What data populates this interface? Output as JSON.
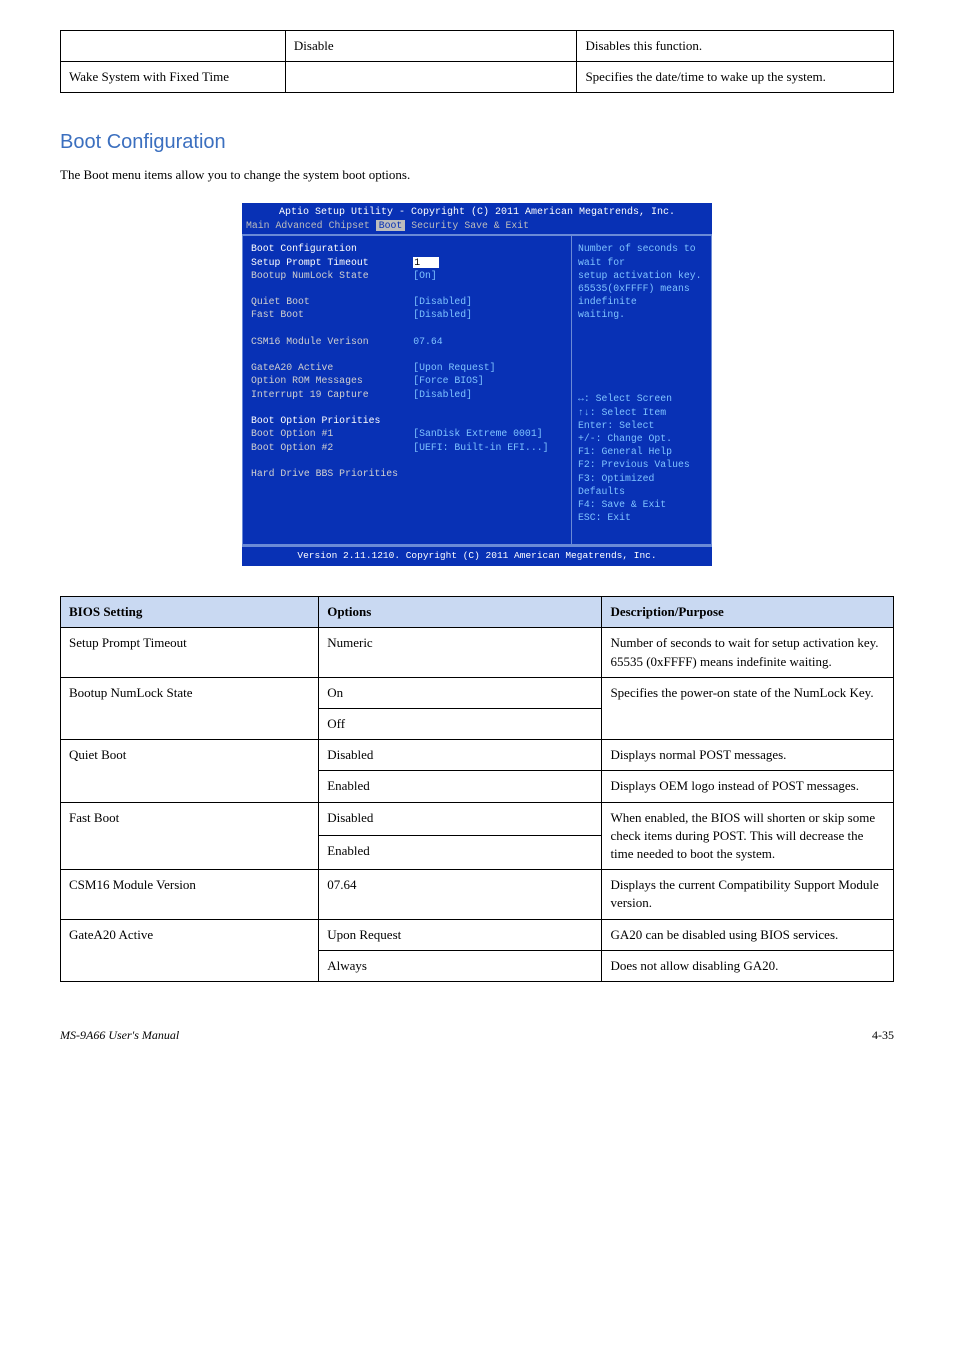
{
  "top_table": {
    "rows": [
      {
        "c1": "",
        "c2": "Disable",
        "c3": "Disables this function."
      },
      {
        "c1": "Wake System with Fixed Time",
        "c2": "",
        "c3": "Specifies the date/time to wake up the system."
      }
    ]
  },
  "section": {
    "heading": "Boot Configuration",
    "sub": "The Boot menu items allow you to change the system boot options."
  },
  "bios": {
    "header": "Aptio Setup Utility - Copyright (C) 2011 American Megatrends, Inc.",
    "tabs": [
      "Main",
      "Advanced",
      "Chipset",
      "Boot",
      "Security",
      "Save & Exit"
    ],
    "selected_tab": 3,
    "left_rows": [
      {
        "lbl": "Boot Configuration",
        "val": "",
        "white": true
      },
      {
        "lbl": "Setup Prompt Timeout",
        "val": "1",
        "white": true,
        "hival": true
      },
      {
        "lbl": "Bootup NumLock State",
        "val": "[On]"
      },
      {
        "lbl": "",
        "val": ""
      },
      {
        "lbl": "Quiet Boot",
        "val": "[Disabled]"
      },
      {
        "lbl": "Fast Boot",
        "val": "[Disabled]"
      },
      {
        "lbl": "",
        "val": ""
      },
      {
        "lbl": "CSM16 Module Verison",
        "val": "07.64"
      },
      {
        "lbl": "",
        "val": ""
      },
      {
        "lbl": "GateA20 Active",
        "val": "[Upon Request]"
      },
      {
        "lbl": "Option ROM Messages",
        "val": "[Force BIOS]"
      },
      {
        "lbl": "Interrupt 19 Capture",
        "val": "[Disabled]"
      },
      {
        "lbl": "",
        "val": ""
      },
      {
        "lbl": "Boot Option Priorities",
        "val": "",
        "white": true
      },
      {
        "lbl": "Boot Option #1",
        "val": "[SanDisk Extreme 0001]"
      },
      {
        "lbl": "Boot Option #2",
        "val": "[UEFI: Built-in EFI...]"
      },
      {
        "lbl": "",
        "val": ""
      },
      {
        "lbl": "Hard Drive BBS Priorities",
        "val": ""
      }
    ],
    "help": [
      "Number of seconds to wait for",
      "setup activation key.",
      "65535(0xFFFF) means indefinite",
      "waiting."
    ],
    "keys": [
      "↔: Select Screen",
      "↑↓: Select Item",
      "Enter: Select",
      "+/-: Change Opt.",
      "F1: General Help",
      "F2: Previous Values",
      "F3: Optimized Defaults",
      "F4: Save & Exit",
      "ESC: Exit"
    ],
    "footer": "Version 2.11.1210. Copyright (C) 2011 American Megatrends, Inc."
  },
  "opt_table": {
    "head": [
      "BIOS Setting",
      "Options",
      "Description/Purpose"
    ],
    "rows": [
      {
        "c1": "Setup Prompt Timeout",
        "c2": "Numeric",
        "c3": "Number of seconds to wait for setup activation key. 65535 (0xFFFF) means indefinite waiting."
      },
      {
        "c1": "Bootup NumLock State",
        "c2": [
          "On",
          "Off"
        ],
        "c3": [
          "Specifies the power-on state of the NumLock Key.",
          ""
        ]
      },
      {
        "c1": "Quiet Boot",
        "c2": "Disabled",
        "c3": "Displays normal POST messages."
      },
      {
        "c1": "",
        "c2": "Enabled",
        "c3": "Displays OEM logo instead of POST messages."
      },
      {
        "c1": "Fast Boot",
        "c2": [
          "Disabled",
          "Enabled"
        ],
        "c3": [
          "When enabled, the BIOS will shorten or skip some check items during POST. This will decrease the time needed to boot the system.",
          ""
        ]
      },
      {
        "c1": "CSM16 Module Version",
        "c2": "07.64",
        "c3": "Displays the current Compatibility Support Module version."
      },
      {
        "c1": "GateA20 Active",
        "c2": "Upon Request",
        "c3": "GA20 can be disabled using BIOS services."
      },
      {
        "c1": "",
        "c2": "Always",
        "c3": "Does not allow disabling GA20."
      }
    ]
  },
  "footer": {
    "left": "MS-9A66 User's Manual",
    "right": "4-35"
  }
}
